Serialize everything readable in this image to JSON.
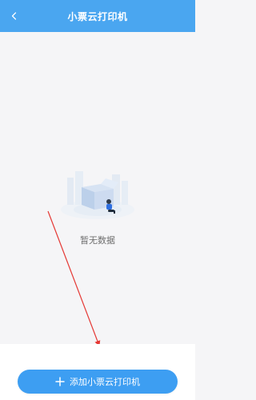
{
  "header": {
    "title": "小票云打印机",
    "back_icon": "chevron-left-icon",
    "background": "#4aa6f0"
  },
  "empty_state": {
    "illustration_icon": "empty-box-with-person-illustration",
    "message": "暂无数据"
  },
  "annotation": {
    "color": "#e53935",
    "type": "arrow"
  },
  "footer": {
    "add_button_label": "添加小票云打印机",
    "add_button_icon": "plus-icon",
    "accent": "#3d9ef2"
  }
}
